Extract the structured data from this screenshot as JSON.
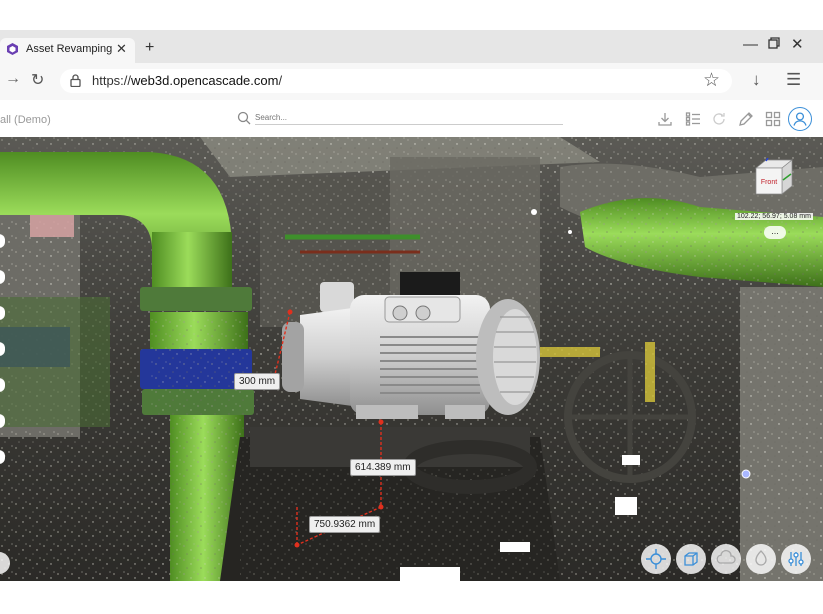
{
  "browser": {
    "tab_title": "Asset Revamping",
    "tab_close": "✕",
    "new_tab": "+",
    "url_prefix": "https://",
    "url_host": "web3d.opencascade.com",
    "url_suffix": "/",
    "window_min": "—",
    "window_close": "✕"
  },
  "app": {
    "project_name": "all (Demo)",
    "search_placeholder": "Search..."
  },
  "viewcube": {
    "face_label": "Front",
    "coords": "102.22; 56.97; 5.08 mm",
    "more": "..."
  },
  "measurements": [
    {
      "label": "300 mm"
    },
    {
      "label": "614.389 mm"
    },
    {
      "label": "750.9362 mm"
    }
  ],
  "colors": {
    "accent": "#3b8fd8",
    "pipe_green": "#79c33a",
    "measure_red": "#e0301e"
  },
  "icons": {
    "toolbar": [
      "download-icon",
      "list-icon",
      "refresh-icon",
      "pencil-icon",
      "grid-icon",
      "user-icon"
    ],
    "viewport_buttons": [
      "move-icon",
      "cube-view-icon",
      "cloud-icon",
      "light-icon",
      "sliders-icon"
    ]
  }
}
